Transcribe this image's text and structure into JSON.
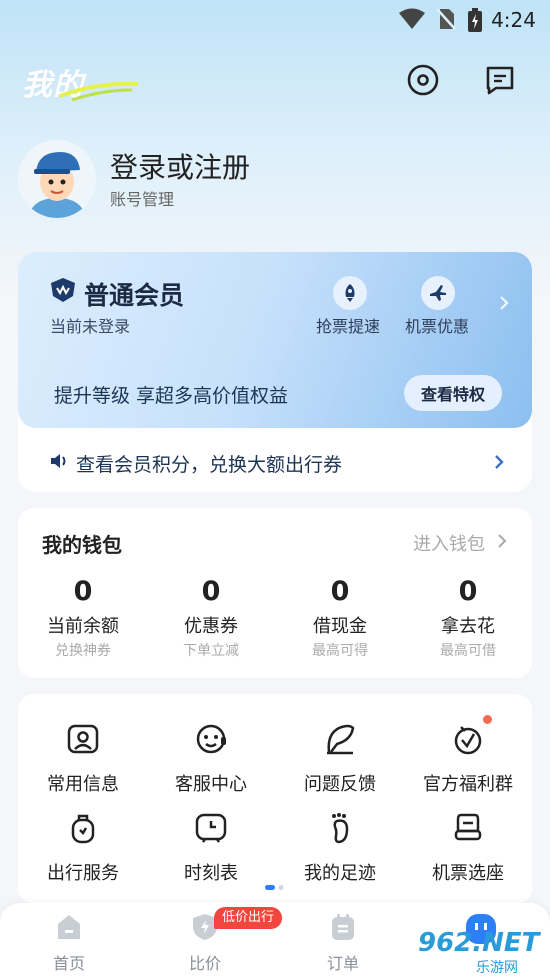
{
  "status_bar": {
    "time": "4:24"
  },
  "header": {
    "title": "我的"
  },
  "user": {
    "login_text": "登录或注册",
    "account_manage": "账号管理"
  },
  "membership": {
    "title": "普通会员",
    "status": "当前未登录",
    "perks": [
      {
        "label": "抢票提速",
        "icon": "rocket-icon"
      },
      {
        "label": "机票优惠",
        "icon": "plane-icon"
      }
    ],
    "upgrade_text": "提升等级 享超多高价值权益",
    "view_button": "查看特权",
    "points_text": "查看会员积分，兑换大额出行券"
  },
  "wallet": {
    "title": "我的钱包",
    "enter_link": "进入钱包",
    "items": [
      {
        "value": "0",
        "label": "当前余额",
        "sub": "兑换神券"
      },
      {
        "value": "0",
        "label": "优惠券",
        "sub": "下单立减"
      },
      {
        "value": "0",
        "label": "借现金",
        "sub": "最高可得"
      },
      {
        "value": "0",
        "label": "拿去花",
        "sub": "最高可借"
      }
    ]
  },
  "services": [
    {
      "label": "常用信息",
      "icon": "id-card-icon"
    },
    {
      "label": "客服中心",
      "icon": "customer-service-icon"
    },
    {
      "label": "问题反馈",
      "icon": "feedback-icon"
    },
    {
      "label": "官方福利群",
      "icon": "welfare-group-icon"
    },
    {
      "label": "出行服务",
      "icon": "luggage-icon"
    },
    {
      "label": "时刻表",
      "icon": "clock-icon"
    },
    {
      "label": "我的足迹",
      "icon": "footprint-icon"
    },
    {
      "label": "机票选座",
      "icon": "seat-icon"
    }
  ],
  "bottom_nav": {
    "items": [
      {
        "label": "首页"
      },
      {
        "label": "比价"
      },
      {
        "label": "订单"
      }
    ],
    "promo_badge": "低价出行"
  },
  "watermark": {
    "text": "962.NET",
    "sub": "乐游网"
  },
  "colors": {
    "accent": "#1c2a44",
    "badge_red": "#f2453d",
    "dot_red": "#f26b4f"
  }
}
